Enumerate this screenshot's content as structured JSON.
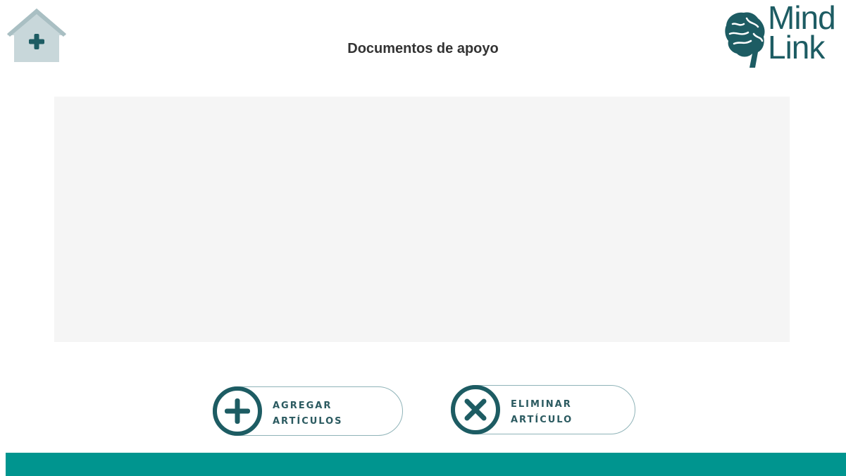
{
  "header": {
    "title": "Documentos de apoyo",
    "home_icon": "home-plus-icon"
  },
  "logo": {
    "line1": "Mind",
    "line2": "Link",
    "icon": "brain-icon"
  },
  "actions": {
    "add": {
      "line1": "AGREGAR",
      "line2": "ARTÍCULOS",
      "icon": "plus-circle-icon"
    },
    "remove": {
      "line1": "ELIMINAR",
      "line2": "ARTÍCULO",
      "icon": "x-circle-icon"
    }
  },
  "colors": {
    "accent": "#00958f",
    "brand_dark": "#1d5c63",
    "home_icon": "#c8d7da",
    "panel": "#f5f5f5"
  }
}
